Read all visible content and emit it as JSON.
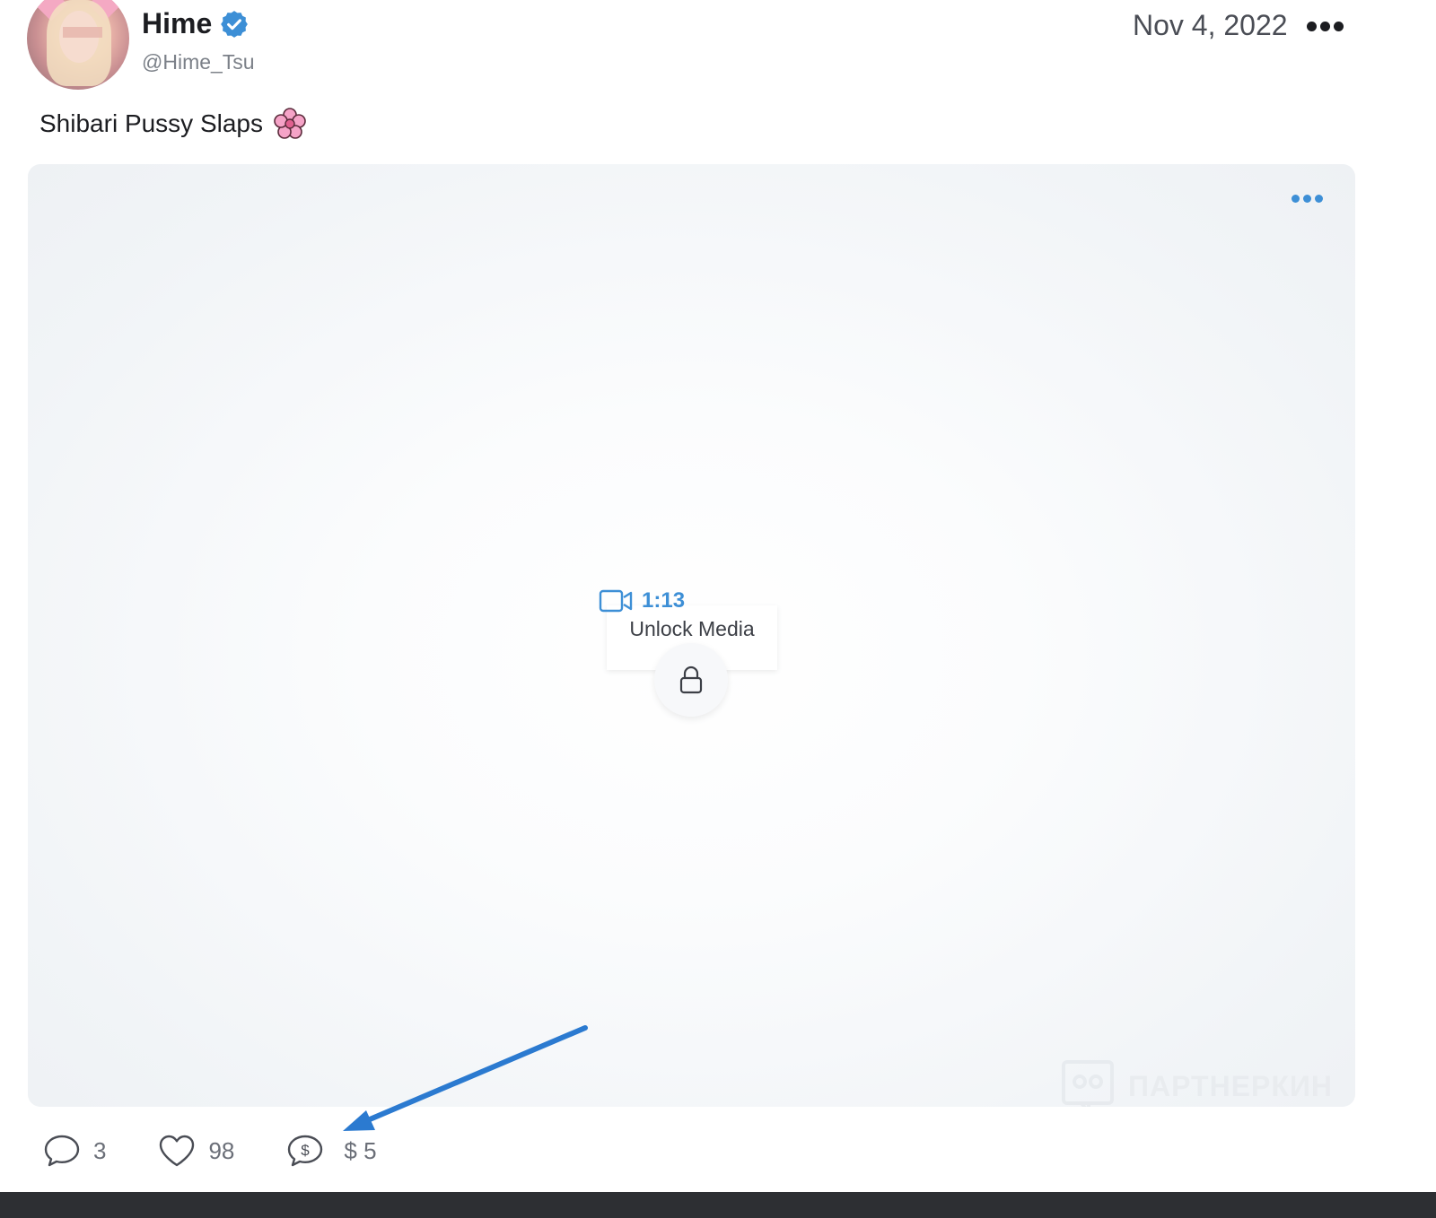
{
  "post": {
    "author": {
      "display_name": "Hime",
      "handle": "@Hime_Tsu",
      "verified": true,
      "avatar": "avatar"
    },
    "date": "Nov 4, 2022",
    "caption": "Shibari Pussy Slaps",
    "caption_emoji": "cherry-blossom-icon"
  },
  "media": {
    "type_icon": "video-icon",
    "duration": "1:13",
    "unlock_label": "Unlock Media",
    "lock_icon": "lock-icon",
    "watermark_text": "ПАРТНЕРКИН"
  },
  "actions": {
    "comments": "3",
    "likes": "98",
    "tip_icon": "tip-icon",
    "price": "$ 5"
  },
  "colors": {
    "accent": "#3d8fd6",
    "text": "#1c1d21",
    "muted": "#7b8088",
    "verified": "#3d8fd6"
  }
}
